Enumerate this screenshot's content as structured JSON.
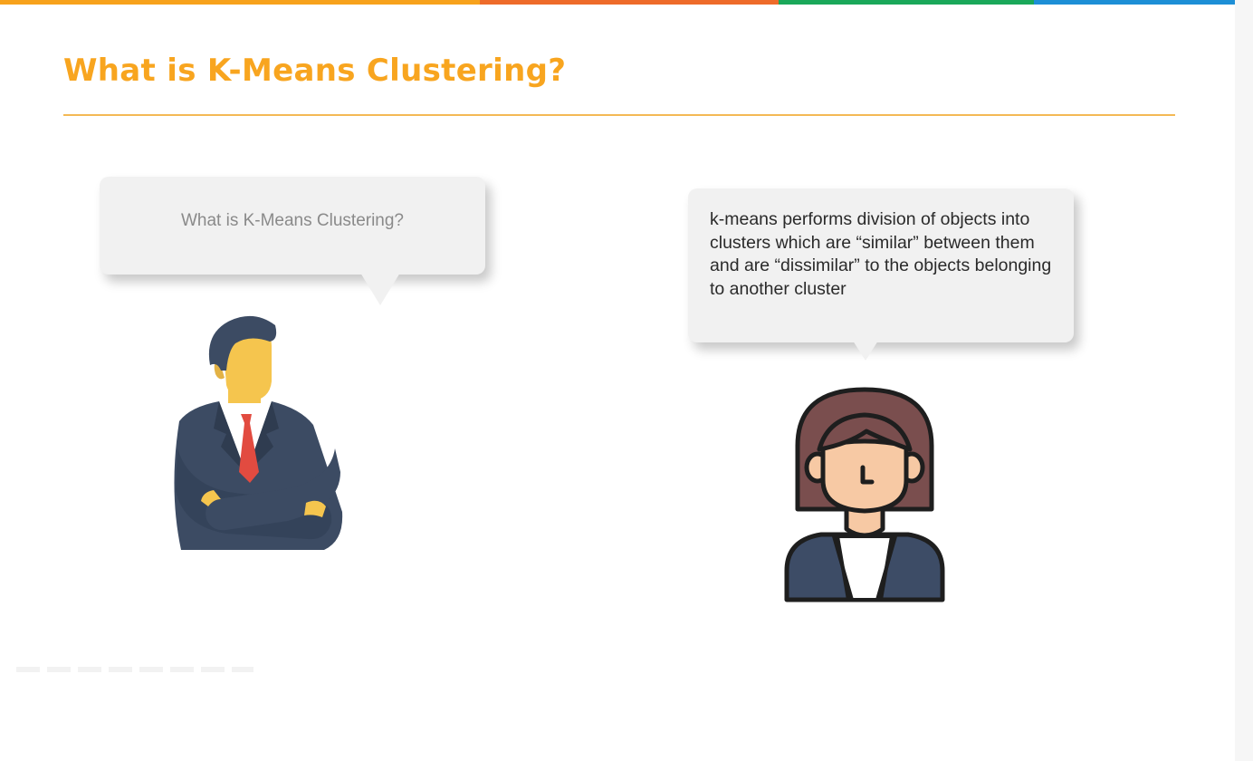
{
  "slide": {
    "title": "What is K-Means Clustering?",
    "title_color": "#f8a51f",
    "top_bar_colors": [
      "#f7a21c",
      "#ee6b2a",
      "#1aa85a",
      "#1d8fd6"
    ]
  },
  "left_bubble": {
    "text": "What is K-Means Clustering?",
    "speaker_icon": "businessman-arms-crossed-icon"
  },
  "right_bubble": {
    "text": "k-means performs division of objects into clusters which are “similar” between them and are “dissimilar” to the objects belonging to another cluster",
    "speaker_icon": "woman-icon"
  }
}
